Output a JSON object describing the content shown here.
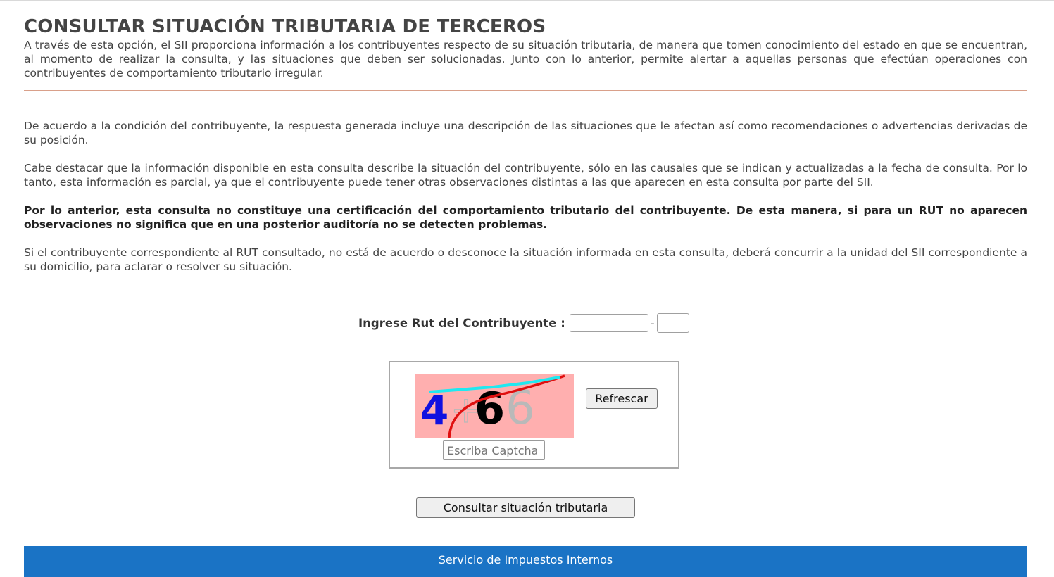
{
  "page": {
    "title": "CONSULTAR SITUACIÓN TRIBUTARIA DE TERCEROS",
    "intro": "A través de esta opción, el SII proporciona información a los contribuyentes respecto de su situación tributaria, de manera que tomen conocimiento del estado en que se encuentran, al momento de realizar la consulta, y las situaciones que deben ser solucionadas. Junto con lo anterior, permite alertar a aquellas personas que efectúan operaciones con contribuyentes de comportamiento tributario irregular."
  },
  "paragraphs": {
    "p1": "De acuerdo a la condición del contribuyente, la respuesta generada incluye una descripción de las situaciones que le afectan así como recomendaciones o advertencias derivadas de su posición.",
    "p2": "Cabe destacar que la información disponible en esta consulta describe la situación del contribuyente, sólo en las causales que se indican y actualizadas a la fecha de consulta. Por lo tanto, esta información es parcial, ya que el contribuyente puede tener otras observaciones distintas a las que aparecen en esta consulta por parte del SII.",
    "p3": "Por lo anterior, esta consulta no constituye una certificación del comportamiento tributario del contribuyente. De esta manera, si para un RUT no aparecen observaciones no significa que en una posterior auditoría no se detecten problemas.",
    "p4": "Si el contribuyente correspondiente al RUT consultado, no está de acuerdo o desconoce la situación informada en esta consulta, deberá concurrir a la unidad del SII correspondiente a su domicilio, para aclarar o resolver su situación."
  },
  "form": {
    "rut_label": "Ingrese Rut del Contribuyente :",
    "rut_value": "",
    "separator": "-",
    "dv_value": "",
    "captcha": {
      "chars": [
        "4",
        "6",
        "6"
      ],
      "background": "#ffafaf",
      "refresh_label": "Refrescar",
      "input_placeholder": "Escriba Captcha",
      "input_value": ""
    },
    "submit_label": "Consultar situación tributaria"
  },
  "footer": {
    "text": "Servicio de Impuestos Internos",
    "color": "#1a73c5"
  }
}
